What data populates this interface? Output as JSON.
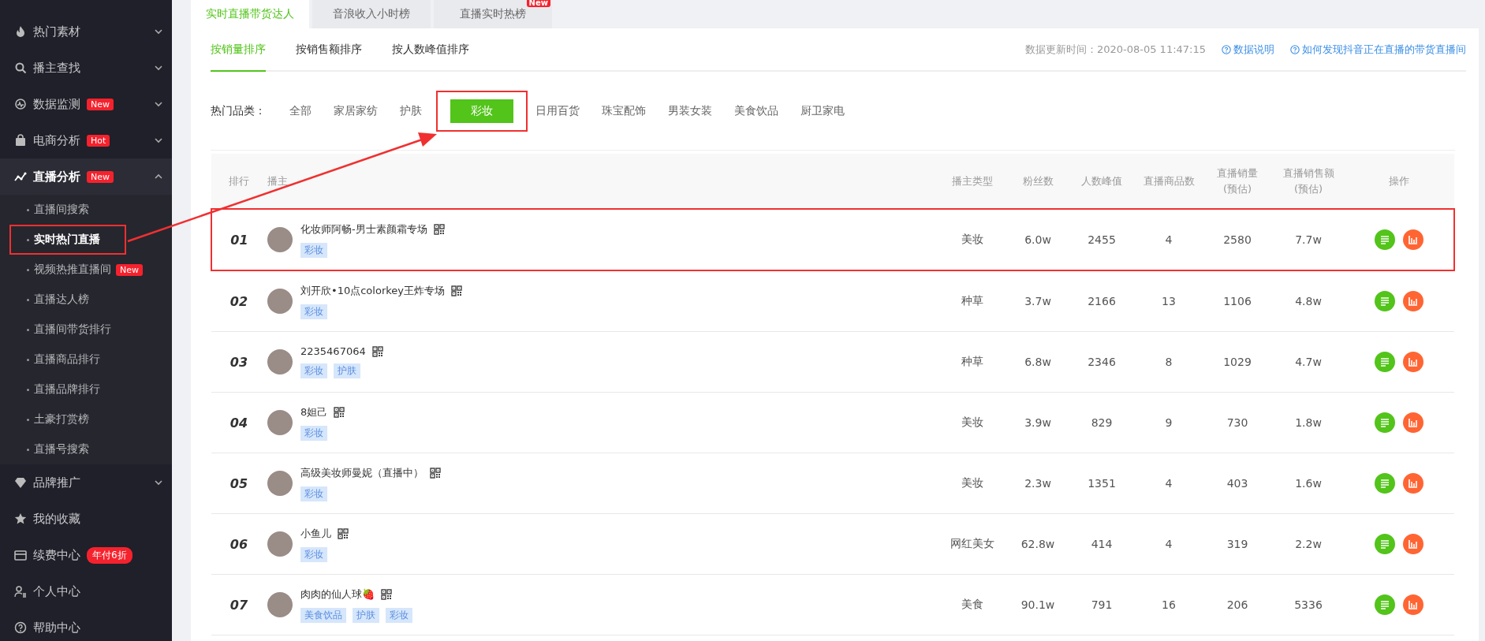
{
  "sidebar": {
    "items": [
      {
        "label": "热门素材",
        "expanded": false
      },
      {
        "label": "播主查找",
        "expanded": false
      },
      {
        "label": "数据监测",
        "badge": "New",
        "expanded": false
      },
      {
        "label": "电商分析",
        "badge": "Hot",
        "expanded": false
      },
      {
        "label": "直播分析",
        "badge": "New",
        "expanded": true,
        "children": [
          {
            "label": "直播间搜索",
            "selected": false,
            "annotated": false
          },
          {
            "label": "实时热门直播",
            "selected": true,
            "annotated": true
          },
          {
            "label": "视频热推直播间",
            "badge": "New",
            "selected": false,
            "annotated": false
          },
          {
            "label": "直播达人榜",
            "selected": false,
            "annotated": false
          },
          {
            "label": "直播间带货排行",
            "selected": false,
            "annotated": false
          },
          {
            "label": "直播商品排行",
            "selected": false,
            "annotated": false
          },
          {
            "label": "直播品牌排行",
            "selected": false,
            "annotated": false
          },
          {
            "label": "土豪打赏榜",
            "selected": false,
            "annotated": false
          },
          {
            "label": "直播号搜索",
            "selected": false,
            "annotated": false
          }
        ]
      },
      {
        "label": "品牌推广",
        "expanded": false
      },
      {
        "label": "我的收藏"
      },
      {
        "label": "续费中心",
        "badge": "年付6折"
      },
      {
        "label": "个人中心"
      },
      {
        "label": "帮助中心"
      }
    ]
  },
  "top_tabs": [
    {
      "label": "实时直播带货达人",
      "selected": true
    },
    {
      "label": "音浪收入小时榜",
      "selected": false
    },
    {
      "label": "直播实时热榜",
      "selected": false,
      "badge": "New"
    }
  ],
  "sort_tabs": [
    {
      "label": "按销量排序",
      "selected": true
    },
    {
      "label": "按销售额排序",
      "selected": false
    },
    {
      "label": "按人数峰值排序",
      "selected": false
    }
  ],
  "update_time": "数据更新时间：2020-08-05 11:47:15",
  "help_links": [
    "数据说明",
    "如何发现抖音正在直播的带货直播间"
  ],
  "categories": {
    "label": "热门品类：",
    "items": [
      {
        "label": "全部",
        "selected": false,
        "annotated": false
      },
      {
        "label": "家居家纺",
        "selected": false,
        "annotated": false
      },
      {
        "label": "护肤",
        "selected": false,
        "annotated": false
      },
      {
        "label": "彩妆",
        "selected": true,
        "annotated": true
      },
      {
        "label": "日用百货",
        "selected": false,
        "annotated": false
      },
      {
        "label": "珠宝配饰",
        "selected": false,
        "annotated": false
      },
      {
        "label": "男装女装",
        "selected": false,
        "annotated": false
      },
      {
        "label": "美食饮品",
        "selected": false,
        "annotated": false
      },
      {
        "label": "厨卫家电",
        "selected": false,
        "annotated": false
      }
    ]
  },
  "table": {
    "columns": [
      {
        "label": "排行"
      },
      {
        "label": "播主"
      },
      {
        "label": "播主类型"
      },
      {
        "label": "粉丝数"
      },
      {
        "label": "人数峰值"
      },
      {
        "label": "直播商品数"
      },
      {
        "label": "直播销量",
        "note": "(预估)"
      },
      {
        "label": "直播销售额",
        "note": "(预估)"
      },
      {
        "label": "操作"
      }
    ],
    "rows": [
      {
        "rank": "01",
        "name": "化妆师阿畅-男士素颜霜专场",
        "tags": [
          "彩妆"
        ],
        "type": "美妆",
        "fans": "6.0w",
        "peak": "2455",
        "goods": "4",
        "sales": "2580",
        "amount": "7.7w",
        "annotated": true
      },
      {
        "rank": "02",
        "name": "刘开欣•10点colorkey王炸专场",
        "tags": [
          "彩妆"
        ],
        "type": "种草",
        "fans": "3.7w",
        "peak": "2166",
        "goods": "13",
        "sales": "1106",
        "amount": "4.8w",
        "annotated": false
      },
      {
        "rank": "03",
        "name": "2235467064",
        "tags": [
          "彩妆",
          "护肤"
        ],
        "type": "种草",
        "fans": "6.8w",
        "peak": "2346",
        "goods": "8",
        "sales": "1029",
        "amount": "4.7w",
        "annotated": false
      },
      {
        "rank": "04",
        "name": "8妲己",
        "tags": [
          "彩妆"
        ],
        "type": "美妆",
        "fans": "3.9w",
        "peak": "829",
        "goods": "9",
        "sales": "730",
        "amount": "1.8w",
        "annotated": false
      },
      {
        "rank": "05",
        "name": "高级美妆师曼妮（直播中）",
        "tags": [
          "彩妆"
        ],
        "type": "美妆",
        "fans": "2.3w",
        "peak": "1351",
        "goods": "4",
        "sales": "403",
        "amount": "1.6w",
        "annotated": false
      },
      {
        "rank": "06",
        "name": "小鱼儿",
        "tags": [
          "彩妆"
        ],
        "type": "网红美女",
        "fans": "62.8w",
        "peak": "414",
        "goods": "4",
        "sales": "319",
        "amount": "2.2w",
        "annotated": false
      },
      {
        "rank": "07",
        "name": "肉肉的仙人球🍓",
        "tags": [
          "美食饮品",
          "护肤",
          "彩妆"
        ],
        "type": "美食",
        "fans": "90.1w",
        "peak": "791",
        "goods": "16",
        "sales": "206",
        "amount": "5336",
        "annotated": false
      }
    ]
  }
}
